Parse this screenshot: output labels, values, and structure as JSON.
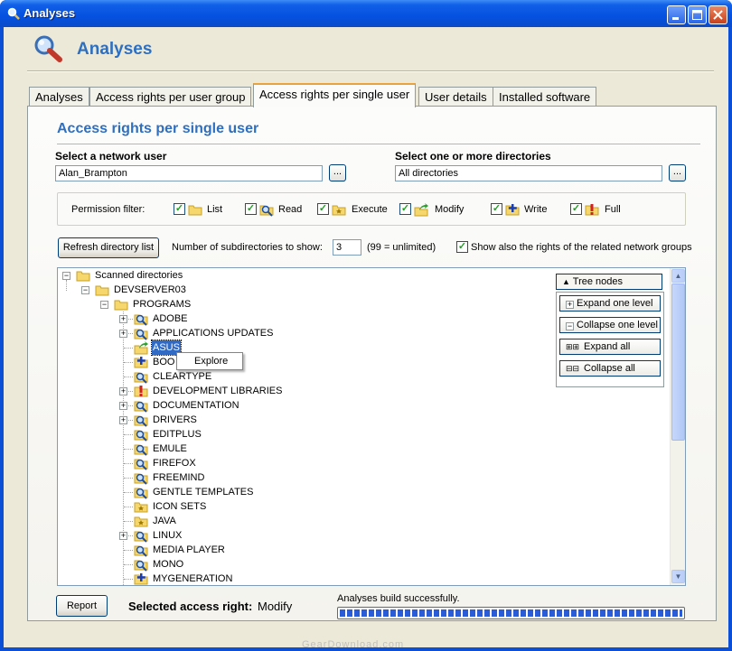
{
  "window": {
    "title": "Analyses"
  },
  "header": {
    "title": "Analyses"
  },
  "tabs": [
    {
      "label": "Analyses"
    },
    {
      "label": "Access rights per user group"
    },
    {
      "label": "Access rights per single user"
    },
    {
      "label": "User details"
    },
    {
      "label": "Installed software"
    }
  ],
  "panel": {
    "title": "Access rights per single user",
    "network_user_label": "Select a network user",
    "network_user_value": "Alan_Brampton",
    "directories_label": "Select one or more directories",
    "directories_value": "All directories",
    "browse_label": "...",
    "permission_filter_label": "Permission filter:",
    "permissions": [
      {
        "label": "List",
        "checked": true,
        "icon": "folder-icon"
      },
      {
        "label": "Read",
        "checked": true,
        "icon": "read-magnifier-icon"
      },
      {
        "label": "Execute",
        "checked": true,
        "icon": "execute-icon"
      },
      {
        "label": "Modify",
        "checked": true,
        "icon": "modify-arrow-icon"
      },
      {
        "label": "Write",
        "checked": true,
        "icon": "write-plus-icon"
      },
      {
        "label": "Full",
        "checked": true,
        "icon": "full-exclamation-icon"
      }
    ],
    "refresh_button": "Refresh directory list",
    "subdir_label": "Number of subdirectories to show:",
    "subdir_value": "3",
    "subdir_hint": "(99 = unlimited)",
    "related_groups_label": "Show also the rights of the related network groups",
    "related_groups_checked": true
  },
  "tree": {
    "root": "Scanned directories",
    "server": "DEVSERVER03",
    "programs": "PROGRAMS",
    "items": [
      {
        "label": "ADOBE",
        "expandable": true,
        "icon": "read"
      },
      {
        "label": "APPLICATIONS UPDATES",
        "expandable": true,
        "icon": "read"
      },
      {
        "label": "ASUS",
        "expandable": false,
        "icon": "modify",
        "selected": true
      },
      {
        "label": "BOO",
        "expandable": false,
        "icon": "write"
      },
      {
        "label": "CLEARTYPE",
        "expandable": false,
        "icon": "read"
      },
      {
        "label": "DEVELOPMENT LIBRARIES",
        "expandable": true,
        "icon": "full"
      },
      {
        "label": "DOCUMENTATION",
        "expandable": true,
        "icon": "read"
      },
      {
        "label": "DRIVERS",
        "expandable": true,
        "icon": "read"
      },
      {
        "label": "EDITPLUS",
        "expandable": false,
        "icon": "read"
      },
      {
        "label": "EMULE",
        "expandable": false,
        "icon": "read"
      },
      {
        "label": "FIREFOX",
        "expandable": false,
        "icon": "read"
      },
      {
        "label": "FREEMIND",
        "expandable": false,
        "icon": "read"
      },
      {
        "label": "GENTLE TEMPLATES",
        "expandable": false,
        "icon": "read"
      },
      {
        "label": "ICON SETS",
        "expandable": false,
        "icon": "execute"
      },
      {
        "label": "JAVA",
        "expandable": false,
        "icon": "execute"
      },
      {
        "label": "LINUX",
        "expandable": true,
        "icon": "read"
      },
      {
        "label": "MEDIA PLAYER",
        "expandable": false,
        "icon": "read"
      },
      {
        "label": "MONO",
        "expandable": false,
        "icon": "read"
      },
      {
        "label": "MYGENERATION",
        "expandable": false,
        "icon": "write"
      }
    ],
    "context_menu": {
      "item": "Explore"
    },
    "tree_nodes": {
      "header": "Tree nodes",
      "expand_one": "Expand one level",
      "collapse_one": "Collapse one level",
      "expand_all": "Expand all",
      "collapse_all": "Collapse all"
    }
  },
  "footer": {
    "report_button": "Report",
    "selected_right_label": "Selected access right:",
    "selected_right_value": "Modify",
    "status": "Analyses build successfully.",
    "progress": 1.0
  },
  "watermark": "GearDownload.com",
  "colors": {
    "accent": "#2e6fc0",
    "titlebar": "#0551e0",
    "progress": "#2a5cd8",
    "selection": "#316ac5"
  }
}
